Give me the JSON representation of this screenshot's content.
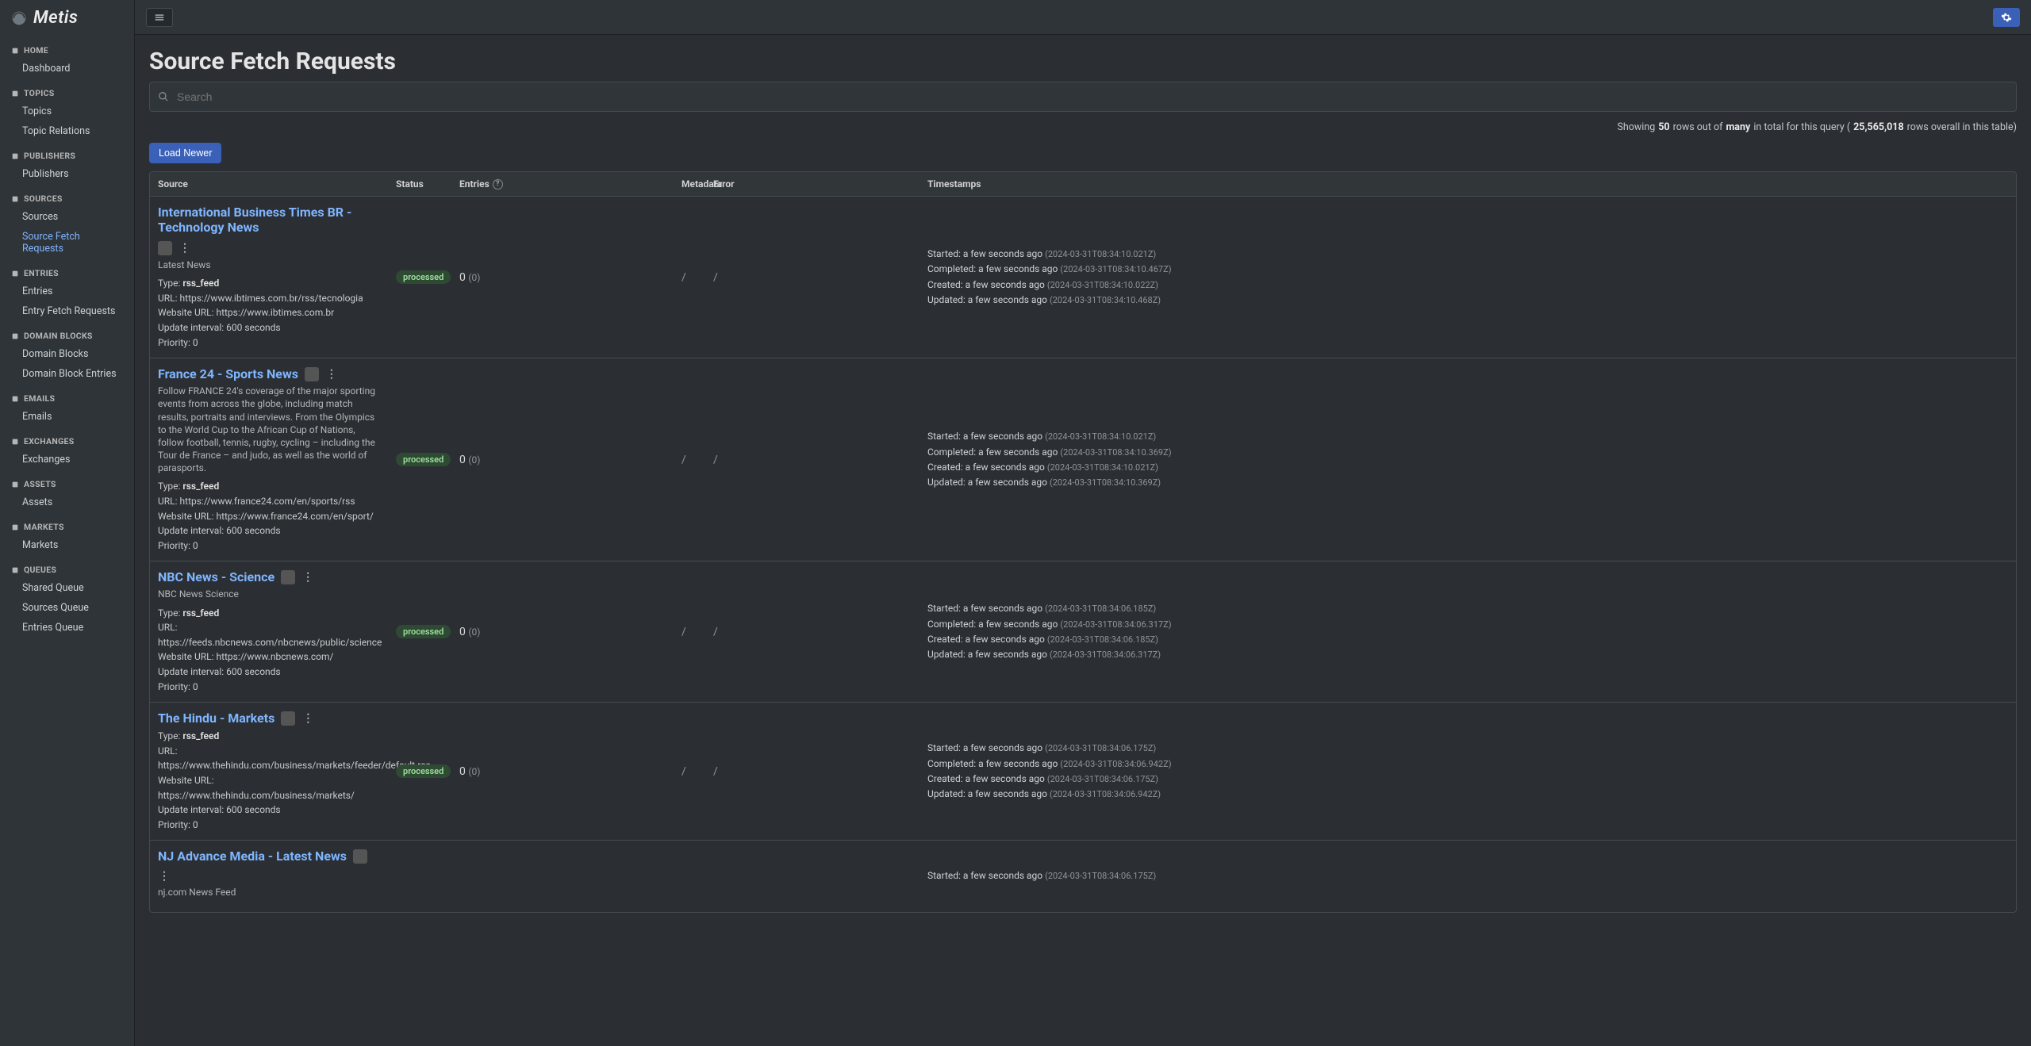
{
  "brand": {
    "name": "Metis"
  },
  "sidebar": {
    "sections": [
      {
        "label": "HOME",
        "items": [
          "Dashboard"
        ]
      },
      {
        "label": "TOPICS",
        "items": [
          "Topics",
          "Topic Relations"
        ]
      },
      {
        "label": "PUBLISHERS",
        "items": [
          "Publishers"
        ]
      },
      {
        "label": "SOURCES",
        "items": [
          "Sources",
          "Source Fetch Requests"
        ],
        "activeIndex": 1
      },
      {
        "label": "ENTRIES",
        "items": [
          "Entries",
          "Entry Fetch Requests"
        ]
      },
      {
        "label": "DOMAIN BLOCKS",
        "items": [
          "Domain Blocks",
          "Domain Block Entries"
        ]
      },
      {
        "label": "EMAILS",
        "items": [
          "Emails"
        ]
      },
      {
        "label": "EXCHANGES",
        "items": [
          "Exchanges"
        ]
      },
      {
        "label": "ASSETS",
        "items": [
          "Assets"
        ]
      },
      {
        "label": "MARKETS",
        "items": [
          "Markets"
        ]
      },
      {
        "label": "QUEUES",
        "items": [
          "Shared Queue",
          "Sources Queue",
          "Entries Queue"
        ]
      }
    ]
  },
  "page": {
    "title": "Source Fetch Requests",
    "search_placeholder": "Search",
    "showing_prefix": "Showing",
    "showing_count": "50",
    "showing_mid1": "rows out of",
    "showing_many": "many",
    "showing_mid2": "in total for this query (",
    "showing_total": "25,565,018",
    "showing_suffix": "rows overall in this table)",
    "load_newer": "Load Newer"
  },
  "columns": {
    "source": "Source",
    "status": "Status",
    "entries": "Entries",
    "metadata": "Metadata",
    "error": "Error",
    "timestamps": "Timestamps"
  },
  "rows": [
    {
      "title": "International Business Times BR - Technology News",
      "desc": "Latest News",
      "type": "rss_feed",
      "url": "https://www.ibtimes.com.br/rss/tecnologia",
      "website": "https://www.ibtimes.com.br",
      "interval": "600 seconds",
      "priority": "0",
      "status": "processed",
      "entries_n": "0",
      "entries_sub": "(0)",
      "metadata": "/",
      "error": "/",
      "ts": {
        "started": {
          "rel": "a few seconds ago",
          "abs": "(2024-03-31T08:34:10.021Z)"
        },
        "completed": {
          "rel": "a few seconds ago",
          "abs": "(2024-03-31T08:34:10.467Z)"
        },
        "created": {
          "rel": "a few seconds ago",
          "abs": "(2024-03-31T08:34:10.022Z)"
        },
        "updated": {
          "rel": "a few seconds ago",
          "abs": "(2024-03-31T08:34:10.468Z)"
        }
      }
    },
    {
      "title": "France 24 - Sports News",
      "desc": "Follow FRANCE 24's coverage of the major sporting events from across the globe, including match results, portraits and interviews. From the Olympics to the World Cup to the African Cup of Nations, follow football, tennis, rugby, cycling – including the Tour de France – and judo, as well as the world of parasports.",
      "type": "rss_feed",
      "url": "https://www.france24.com/en/sports/rss",
      "website": "https://www.france24.com/en/sport/",
      "interval": "600 seconds",
      "priority": "0",
      "status": "processed",
      "entries_n": "0",
      "entries_sub": "(0)",
      "metadata": "/",
      "error": "/",
      "ts": {
        "started": {
          "rel": "a few seconds ago",
          "abs": "(2024-03-31T08:34:10.021Z)"
        },
        "completed": {
          "rel": "a few seconds ago",
          "abs": "(2024-03-31T08:34:10.369Z)"
        },
        "created": {
          "rel": "a few seconds ago",
          "abs": "(2024-03-31T08:34:10.021Z)"
        },
        "updated": {
          "rel": "a few seconds ago",
          "abs": "(2024-03-31T08:34:10.369Z)"
        }
      }
    },
    {
      "title": "NBC News - Science",
      "desc": "NBC News Science",
      "type": "rss_feed",
      "url": "https://feeds.nbcnews.com/nbcnews/public/science",
      "website": "https://www.nbcnews.com/",
      "interval": "600 seconds",
      "priority": "0",
      "status": "processed",
      "entries_n": "0",
      "entries_sub": "(0)",
      "metadata": "/",
      "error": "/",
      "ts": {
        "started": {
          "rel": "a few seconds ago",
          "abs": "(2024-03-31T08:34:06.185Z)"
        },
        "completed": {
          "rel": "a few seconds ago",
          "abs": "(2024-03-31T08:34:06.317Z)"
        },
        "created": {
          "rel": "a few seconds ago",
          "abs": "(2024-03-31T08:34:06.185Z)"
        },
        "updated": {
          "rel": "a few seconds ago",
          "abs": "(2024-03-31T08:34:06.317Z)"
        }
      }
    },
    {
      "title": "The Hindu - Markets",
      "desc": "",
      "type": "rss_feed",
      "url": "https://www.thehindu.com/business/markets/feeder/default.rss",
      "website": "https://www.thehindu.com/business/markets/",
      "interval": "600 seconds",
      "priority": "0",
      "status": "processed",
      "entries_n": "0",
      "entries_sub": "(0)",
      "metadata": "/",
      "error": "/",
      "ts": {
        "started": {
          "rel": "a few seconds ago",
          "abs": "(2024-03-31T08:34:06.175Z)"
        },
        "completed": {
          "rel": "a few seconds ago",
          "abs": "(2024-03-31T08:34:06.942Z)"
        },
        "created": {
          "rel": "a few seconds ago",
          "abs": "(2024-03-31T08:34:06.175Z)"
        },
        "updated": {
          "rel": "a few seconds ago",
          "abs": "(2024-03-31T08:34:06.942Z)"
        }
      }
    },
    {
      "title": "NJ Advance Media - Latest News",
      "desc": "nj.com News Feed",
      "type": "",
      "url": "",
      "website": "",
      "interval": "",
      "priority": "",
      "status": "",
      "entries_n": "",
      "entries_sub": "",
      "metadata": "",
      "error": "",
      "ts": {
        "started": {
          "rel": "a few seconds ago",
          "abs": "(2024-03-31T08:34:06.175Z)"
        },
        "completed": {
          "rel": "",
          "abs": ""
        },
        "created": {
          "rel": "",
          "abs": ""
        },
        "updated": {
          "rel": "",
          "abs": ""
        }
      }
    }
  ],
  "labels": {
    "type": "Type:",
    "url": "URL:",
    "website": "Website URL:",
    "interval": "Update interval:",
    "priority": "Priority:",
    "started": "Started:",
    "completed": "Completed:",
    "created": "Created:",
    "updated": "Updated:"
  }
}
